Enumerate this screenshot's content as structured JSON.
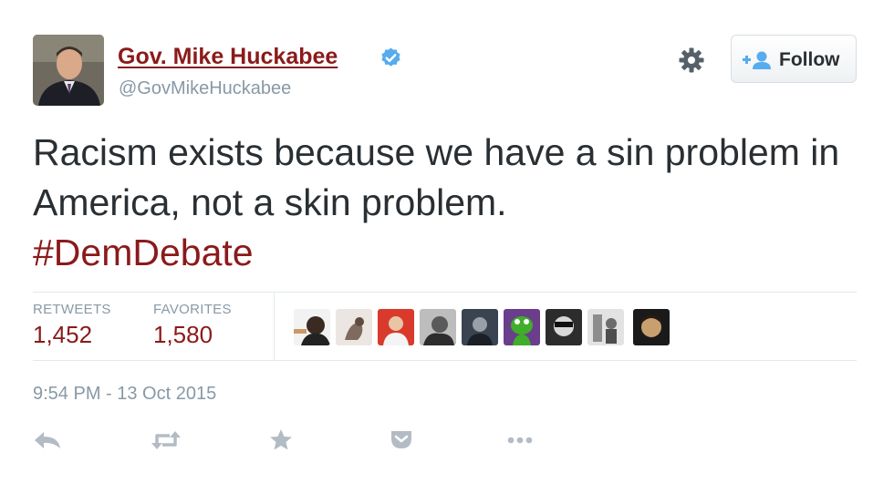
{
  "user": {
    "name": "Gov. Mike Huckabee",
    "handle": "@GovMikeHuckabee",
    "verified": true,
    "avatar_icon": "profile-photo"
  },
  "header": {
    "settings_icon": "gear-icon",
    "follow_label": "Follow",
    "follow_icon": "add-user-icon"
  },
  "tweet": {
    "text": "Racism exists because we have a sin problem in America, not a skin problem. ",
    "hashtag": "#DemDebate"
  },
  "stats": {
    "retweets_label": "RETWEETS",
    "retweets_value": "1,452",
    "favorites_label": "FAVORITES",
    "favorites_value": "1,580"
  },
  "favoriters_count_shown": 9,
  "timestamp": "9:54 PM - 13 Oct 2015",
  "actions": [
    "reply-icon",
    "retweet-icon",
    "favorite-icon",
    "pocket-icon",
    "more-icon"
  ],
  "colors": {
    "link": "#8b1a1a",
    "muted": "#8899a6",
    "verified": "#55acee"
  }
}
